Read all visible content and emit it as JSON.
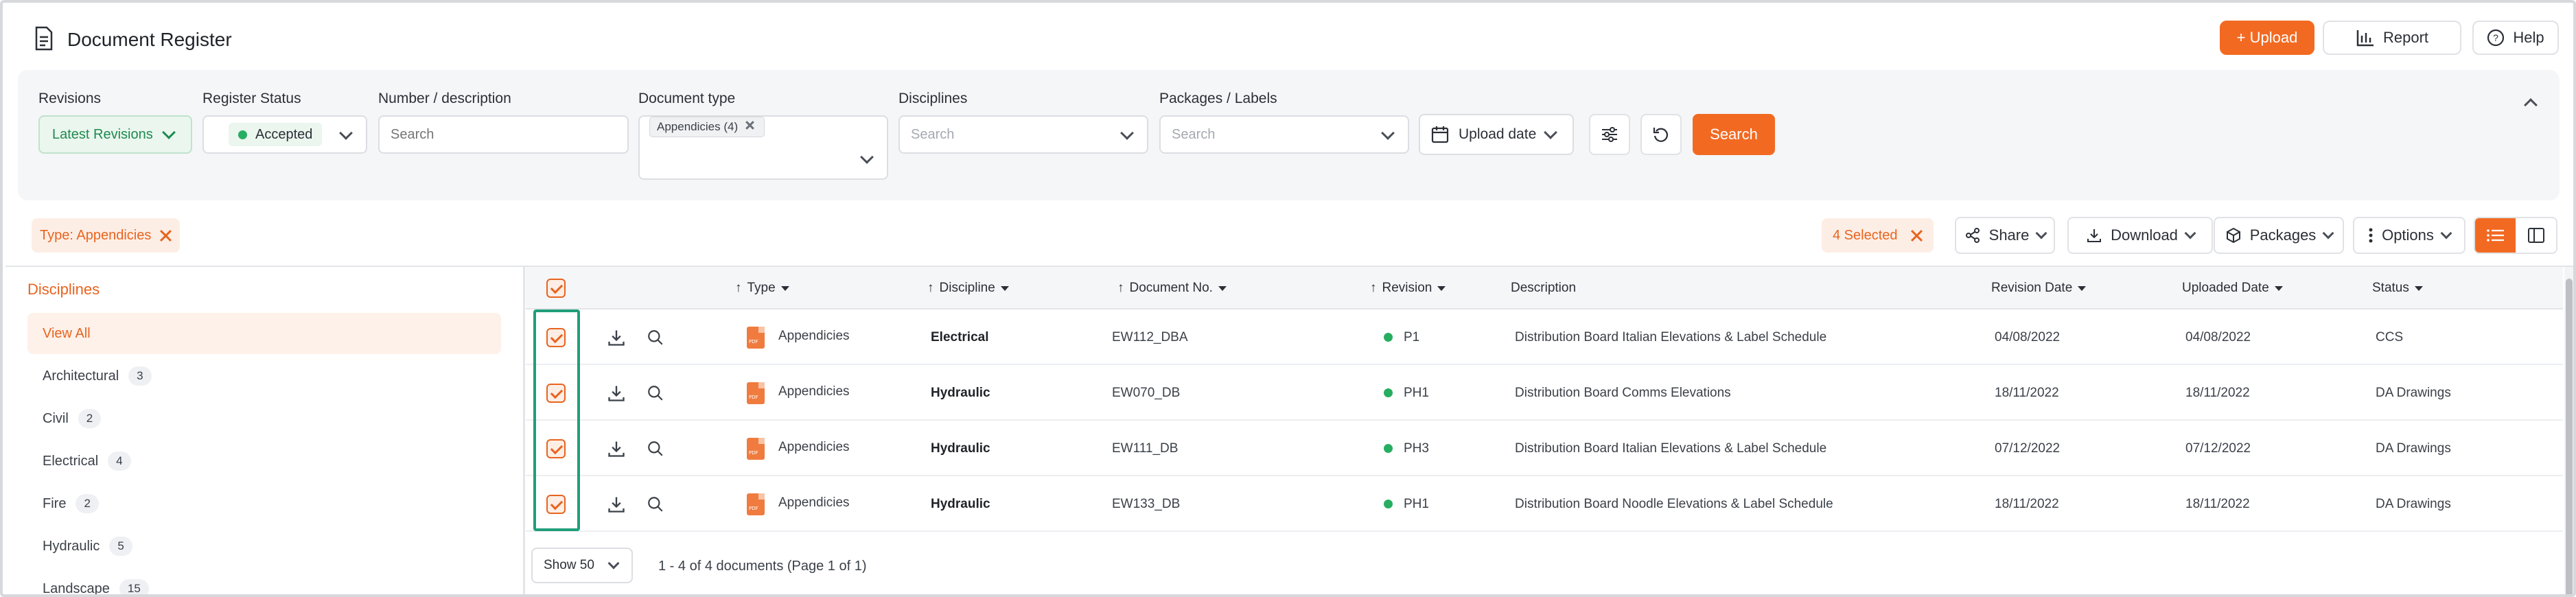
{
  "header": {
    "title": "Document Register",
    "upload_label": "+ Upload",
    "report_label": "Report",
    "help_label": "Help"
  },
  "filters": {
    "revisions": {
      "label": "Revisions",
      "value": "Latest Revisions"
    },
    "register_status": {
      "label": "Register Status",
      "value": "Accepted"
    },
    "number": {
      "label": "Number / description",
      "placeholder": "Search"
    },
    "doc_type": {
      "label": "Document type",
      "tag": "Appendicies (4)"
    },
    "disciplines": {
      "label": "Disciplines",
      "placeholder": "Search"
    },
    "packages": {
      "label": "Packages / Labels",
      "placeholder": "Search"
    },
    "upload_date": "Upload date",
    "search_label": "Search"
  },
  "active_filter": {
    "key": "Type:",
    "value": "Appendicies"
  },
  "toolbar": {
    "selected": "4 Selected",
    "share": "Share",
    "download": "Download",
    "packages": "Packages",
    "options": "Options"
  },
  "sidebar": {
    "title": "Disciplines",
    "view_all": "View All",
    "items": [
      {
        "label": "Architectural",
        "count": "3"
      },
      {
        "label": "Civil",
        "count": "2"
      },
      {
        "label": "Electrical",
        "count": "4"
      },
      {
        "label": "Fire",
        "count": "2"
      },
      {
        "label": "Hydraulic",
        "count": "5"
      },
      {
        "label": "Landscape",
        "count": "15"
      }
    ]
  },
  "table": {
    "headers": {
      "type": "Type",
      "discipline": "Discipline",
      "doc_no": "Document No.",
      "revision": "Revision",
      "description": "Description",
      "revision_date": "Revision Date",
      "uploaded_date": "Uploaded Date",
      "status": "Status"
    },
    "rows": [
      {
        "type": "Appendicies",
        "discipline": "Electrical",
        "doc_no": "EW112_DBA",
        "revision": "P1",
        "description": "Distribution Board Italian Elevations & Label Schedule",
        "revision_date": "04/08/2022",
        "uploaded_date": "04/08/2022",
        "status": "CCS"
      },
      {
        "type": "Appendicies",
        "discipline": "Hydraulic",
        "doc_no": "EW070_DB",
        "revision": "PH1",
        "description": "Distribution Board Comms Elevations",
        "revision_date": "18/11/2022",
        "uploaded_date": "18/11/2022",
        "status": "DA Drawings"
      },
      {
        "type": "Appendicies",
        "discipline": "Hydraulic",
        "doc_no": "EW111_DB",
        "revision": "PH3",
        "description": "Distribution Board Italian Elevations & Label Schedule",
        "revision_date": "07/12/2022",
        "uploaded_date": "07/12/2022",
        "status": "DA Drawings"
      },
      {
        "type": "Appendicies",
        "discipline": "Hydraulic",
        "doc_no": "EW133_DB",
        "revision": "PH1",
        "description": "Distribution Board Noodle Elevations & Label Schedule",
        "revision_date": "18/11/2022",
        "uploaded_date": "18/11/2022",
        "status": "DA Drawings"
      }
    ]
  },
  "footer": {
    "show": "Show 50",
    "summary": "1 - 4 of 4 documents (Page 1 of 1)"
  }
}
